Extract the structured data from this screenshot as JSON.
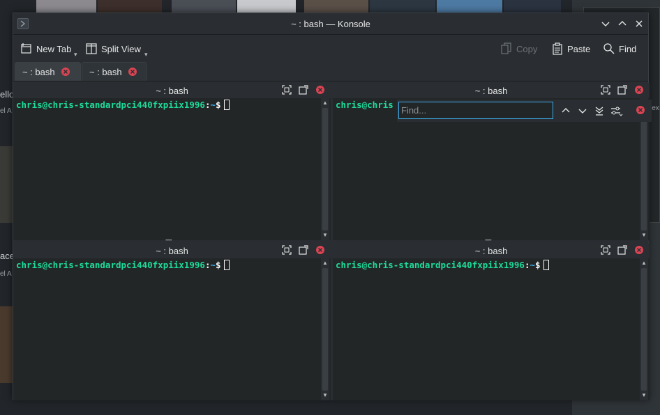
{
  "window": {
    "title": "~ : bash — Konsole"
  },
  "toolbar": {
    "new_tab": "New Tab",
    "split_view": "Split View",
    "copy": "Copy",
    "paste": "Paste",
    "find": "Find"
  },
  "tabs": [
    {
      "label": "~ : bash",
      "active": true
    },
    {
      "label": "~ : bash",
      "active": false
    }
  ],
  "panes": [
    {
      "title": "~ : bash",
      "prompt_user": "chris@chris-standardpci440fxpiix1996",
      "prompt_path": "~",
      "prompt_symbol": "$"
    },
    {
      "title": "~ : bash",
      "prompt_user": "chris@chris",
      "prompt_path": "",
      "prompt_symbol": ""
    },
    {
      "title": "~ : bash",
      "prompt_user": "chris@chris-standardpci440fxpiix1996",
      "prompt_path": "~",
      "prompt_symbol": "$"
    },
    {
      "title": "~ : bash",
      "prompt_user": "chris@chris-standardpci440fxpiix1996",
      "prompt_path": "~",
      "prompt_symbol": "$"
    }
  ],
  "find_bar": {
    "placeholder": "Find..."
  },
  "background": {
    "text_1": "ello",
    "text_2": "el A",
    "text_3": "ace",
    "text_4": "el A",
    "text_5": "lex"
  },
  "colors": {
    "accent": "#3daee9",
    "prompt_user": "#1cdc9a",
    "close_red": "#da4453",
    "window_bg": "#2a2e32",
    "terminal_bg": "#232627"
  }
}
